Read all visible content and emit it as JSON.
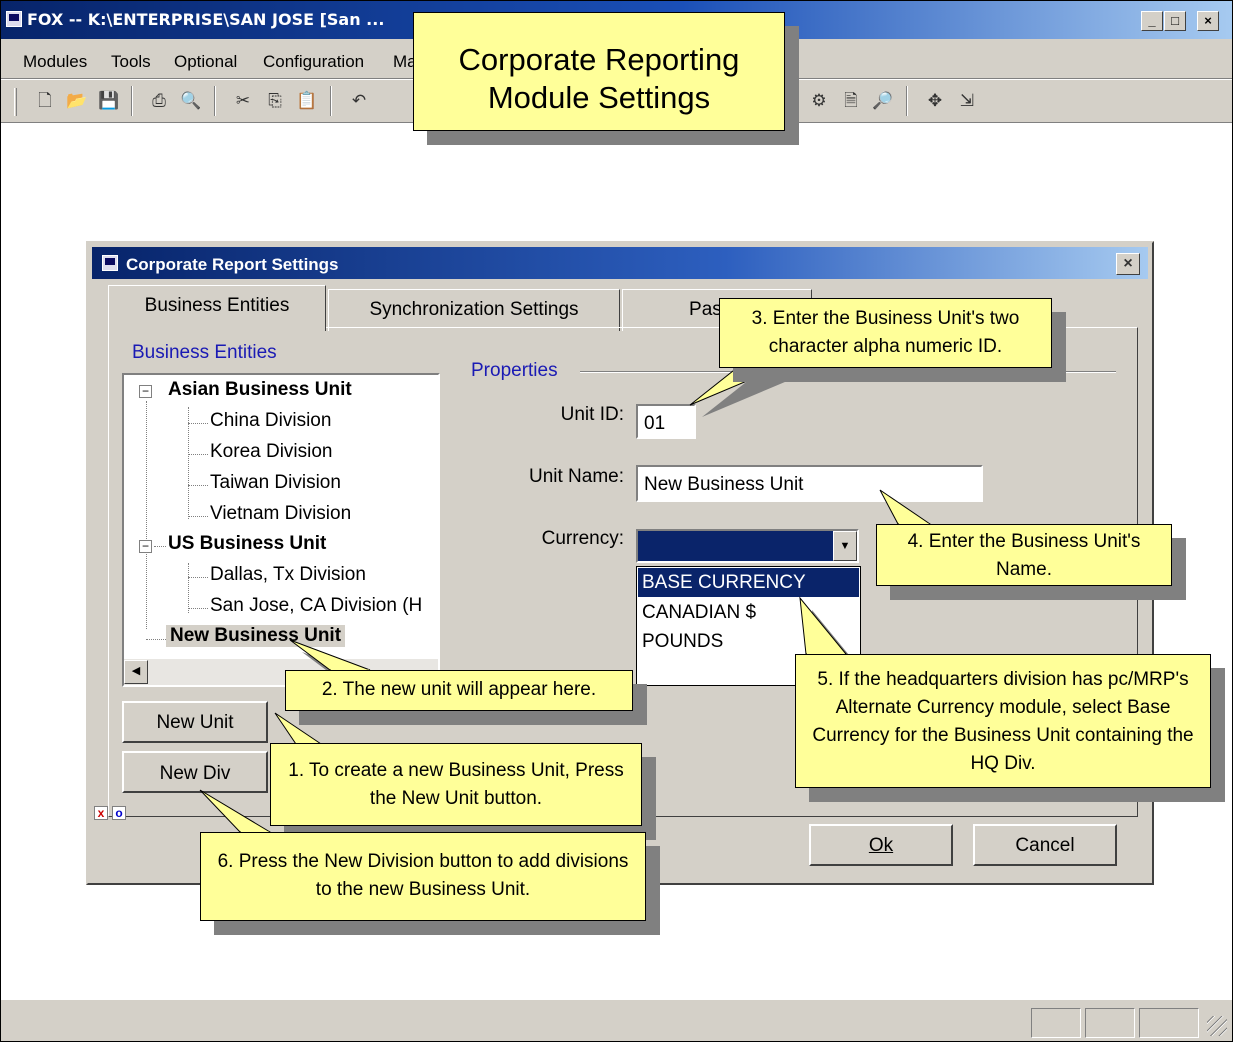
{
  "window": {
    "title": "FOX -- K:\\ENTERPRISE\\SAN JOSE  [San ...",
    "min_symbol": "_",
    "max_symbol": "□",
    "close_symbol": "×"
  },
  "menu": [
    "Modules",
    "Tools",
    "Optional",
    "Configuration",
    "Ma"
  ],
  "toolbar_icons": [
    "new-file-icon",
    "open-folder-icon",
    "save-icon",
    "print-icon",
    "print-preview-icon",
    "cut-icon",
    "copy-icon",
    "paste-icon",
    "undo-icon",
    "properties-icon",
    "properties-sheet-icon",
    "find-document-icon",
    "navigate-icon",
    "export-icon"
  ],
  "dialog": {
    "title": "Corporate Report Settings",
    "close_symbol": "×",
    "tabs": [
      "Business Entities",
      "Synchronization Settings",
      "Passw"
    ],
    "entities_label": "Business Entities",
    "properties_label": "Properties",
    "tree": [
      {
        "label": "Asian Business Unit",
        "level": 0,
        "bold": true,
        "expander": "−"
      },
      {
        "label": "China Division",
        "level": 1
      },
      {
        "label": "Korea Division",
        "level": 1
      },
      {
        "label": "Taiwan Division",
        "level": 1
      },
      {
        "label": "Vietnam Division",
        "level": 1
      },
      {
        "label": "US Business Unit",
        "level": 0,
        "bold": true,
        "expander": "−"
      },
      {
        "label": "Dallas, Tx Division",
        "level": 1
      },
      {
        "label": "San Jose, CA Division (H",
        "level": 1
      },
      {
        "label": "New Business Unit",
        "level": 0,
        "bold": true,
        "selected": true
      }
    ],
    "fields": {
      "unit_id_label": "Unit ID:",
      "unit_id_value": "01",
      "unit_name_label": "Unit Name:",
      "unit_name_value": "New Business Unit",
      "currency_label": "Currency:"
    },
    "currency_options": [
      "BASE CURRENCY",
      "CANADIAN $",
      "POUNDS"
    ],
    "selected_currency_index": 0,
    "buttons": {
      "new_unit": "New Unit",
      "new_div": "New Div",
      "ok": "Ok",
      "cancel": "Cancel"
    },
    "mini_icons": [
      "x",
      "o"
    ]
  },
  "callouts": {
    "title": "Corporate Reporting Module Settings",
    "c1": "1.  To create a new Business Unit, Press the New Unit button.",
    "c2": "2.  The new unit will appear here.",
    "c3": "3.  Enter the Business Unit's two character alpha numeric ID.",
    "c4": "4.  Enter the Business Unit's Name.",
    "c5": "5.  If the headquarters division has pc/MRP's Alternate Currency module, select Base Currency for the Business Unit containing the HQ Div.",
    "c6": "6.  Press the New Division button to add divisions to the new Business Unit."
  },
  "colors": {
    "window_face": "#d4d0c8",
    "title_blue": "#0a246a",
    "callout_yellow": "#ffff99",
    "label_blue": "#1a1ab4"
  }
}
